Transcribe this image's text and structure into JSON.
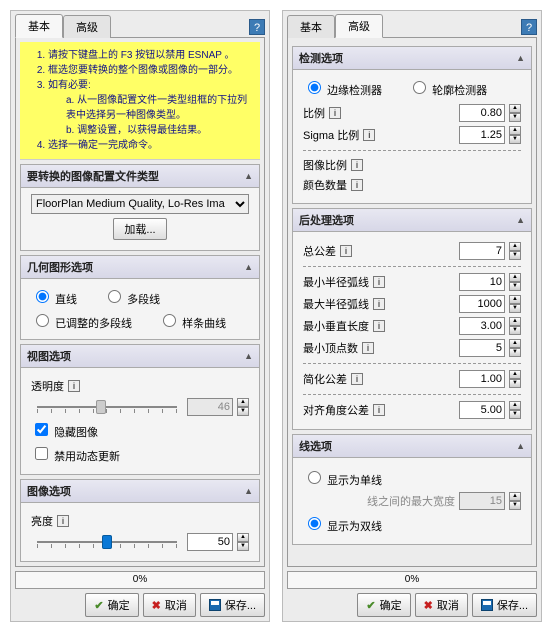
{
  "common": {
    "tab_basic": "基本",
    "tab_advanced": "高级",
    "help": "?",
    "progress": "0%",
    "btn_ok": "确定",
    "btn_cancel": "取消",
    "btn_save": "保存..."
  },
  "left": {
    "notice": {
      "l1": "请按下键盘上的 F3 按钮以禁用 ESNAP 。",
      "l2": "框选您要转换的整个图像或图像的一部分。",
      "l3": "如有必要:",
      "l3a": "a. 从一图像配置文件一类型组框的下拉列表中选择另一种图像类型。",
      "l3b": "b. 调整设置，以获得最佳结果。",
      "l4": "选择一确定一完成命令。"
    },
    "grp_profile": {
      "title": "要转换的图像配置文件类型",
      "select_value": "FloorPlan Medium Quality, Lo-Res Ima",
      "btn_load": "加载..."
    },
    "grp_geom": {
      "title": "几何图形选项",
      "opt_line": "直线",
      "opt_polyline": "多段线",
      "opt_tuned_polyline": "已调整的多段线",
      "opt_spline": "样条曲线"
    },
    "grp_view": {
      "title": "视图选项",
      "transparency": "透明度",
      "transparency_val": "46",
      "chk_hide": "隐藏图像",
      "chk_dyn": "禁用动态更新"
    },
    "grp_image": {
      "title": "图像选项",
      "brightness": "亮度",
      "brightness_val": "50"
    }
  },
  "right": {
    "grp_detect": {
      "title": "检测选项",
      "opt_edge": "边缘检测器",
      "opt_contour": "轮廓检测器",
      "ratio": "比例",
      "ratio_val": "0.80",
      "sigma": "Sigma 比例",
      "sigma_val": "1.25",
      "img_ratio": "图像比例",
      "color_count": "颜色数量"
    },
    "grp_post": {
      "title": "后处理选项",
      "total_tol": "总公差",
      "total_tol_val": "7",
      "min_arc": "最小半径弧线",
      "min_arc_val": "10",
      "max_arc": "最大半径弧线",
      "max_arc_val": "1000",
      "min_vert_len": "最小垂直长度",
      "min_vert_len_val": "3.00",
      "min_vertices": "最小顶点数",
      "min_vertices_val": "5",
      "simplify_tol": "简化公差",
      "simplify_tol_val": "1.00",
      "align_tol": "对齐角度公差",
      "align_tol_val": "5.00"
    },
    "grp_line": {
      "title": "线选项",
      "opt_single": "显示为单线",
      "max_width_label": "线之间的最大宽度",
      "max_width_val": "15",
      "opt_double": "显示为双线"
    }
  },
  "chart_data": null
}
